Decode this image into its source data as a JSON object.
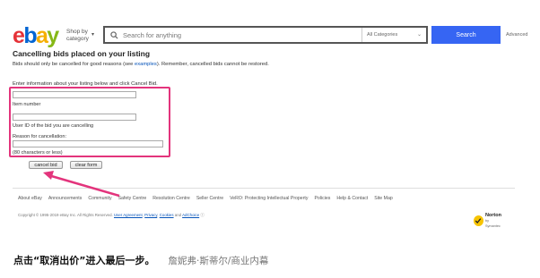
{
  "header": {
    "logo_letters": [
      {
        "ch": "e",
        "color": "#e53238"
      },
      {
        "ch": "b",
        "color": "#0064d2"
      },
      {
        "ch": "a",
        "color": "#f5af02"
      },
      {
        "ch": "y",
        "color": "#86b817"
      }
    ],
    "shop_by_line1": "Shop by",
    "shop_by_line2": "category",
    "search_placeholder": "Search for anything",
    "category_select": "All Categories",
    "search_button": "Search",
    "advanced_link": "Advanced"
  },
  "main": {
    "title": "Cancelling bids placed on your listing",
    "intro_before_link": "Bids should only be cancelled for good reasons (see ",
    "intro_link": "examples",
    "intro_after_link": "). Remember, cancelled bids cannot be restored.",
    "enter_info": "Enter information about your listing below and click Cancel Bid.",
    "item_number_label": "Item number",
    "user_id_label": "User ID of the bid you are cancelling",
    "reason_label": "Reason for cancellation:",
    "char_limit": "(80 characters or less)",
    "cancel_bid_button": "cancel bid",
    "clear_form_button": "clear form"
  },
  "footer": {
    "links": [
      "About eBay",
      "Announcements",
      "Community",
      "Safety Centre",
      "Resolution Centre",
      "Seller Centre",
      "VeRO: Protecting Intellectual Property",
      "Policies",
      "Help & Contact",
      "Site Map"
    ],
    "copyright_prefix": "Copyright © 1995-2019 eBay Inc. All Rights Reserved.",
    "user_agreement": "User Agreement",
    "privacy": "Privacy",
    "cookies": "Cookies",
    "adchoice": "AdChoice",
    "norton_name": "Norton",
    "norton_sub": "by Symantec"
  },
  "caption": {
    "text": "点击“取消出价”进入最后一步。",
    "credit": "詹妮弗·斯蒂尔/商业内幕"
  },
  "colors": {
    "accent_pink": "#e3347c",
    "search_blue": "#3665f3",
    "link_blue": "#0654ba"
  }
}
